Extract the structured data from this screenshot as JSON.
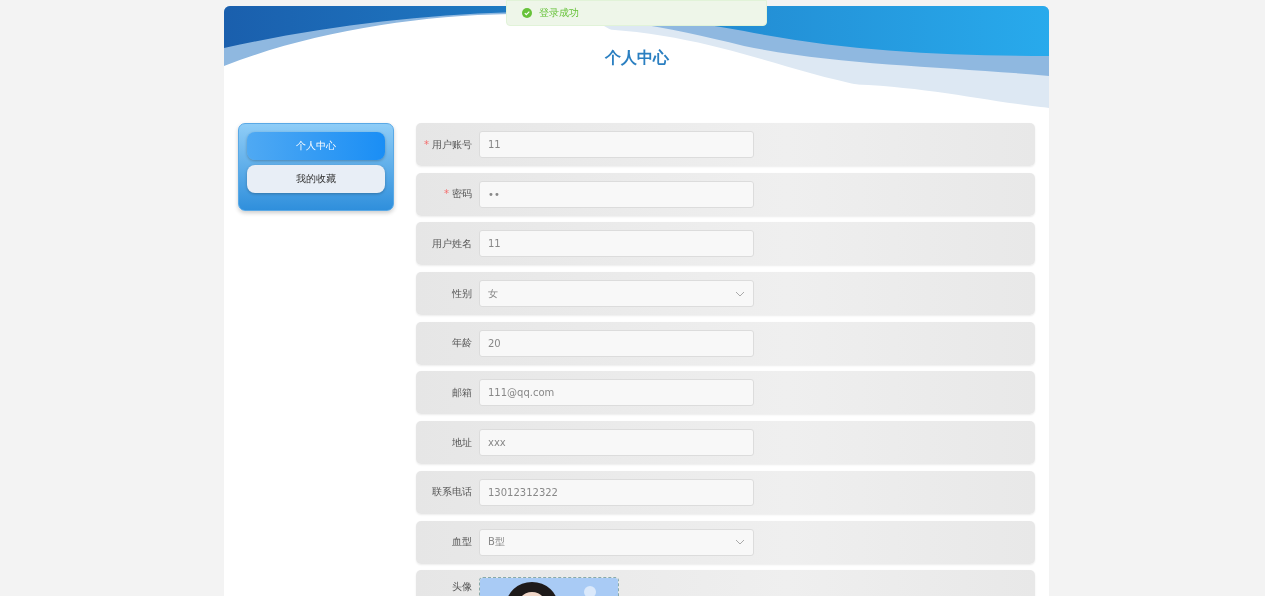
{
  "toast": {
    "kind": "success",
    "message": "登录成功"
  },
  "title": "个人中心",
  "sidebar": {
    "items": [
      {
        "label": "个人中心",
        "selected": true
      },
      {
        "label": "我的收藏",
        "selected": false
      }
    ]
  },
  "form": {
    "fields": [
      {
        "label": "用户账号",
        "required_mark": "*",
        "kind": "input",
        "value": "11"
      },
      {
        "label": "密码",
        "required_mark": "*",
        "kind": "input",
        "value": "••"
      },
      {
        "label": "用户姓名",
        "kind": "input",
        "value": "11"
      },
      {
        "label": "性别",
        "kind": "select",
        "value": "女"
      },
      {
        "label": "年龄",
        "kind": "input",
        "value": "20"
      },
      {
        "label": "邮箱",
        "kind": "input",
        "value": "111@qq.com"
      },
      {
        "label": "地址",
        "kind": "input",
        "value": "xxx"
      },
      {
        "label": "联系电话",
        "kind": "input",
        "value": "13012312322"
      },
      {
        "label": "血型",
        "kind": "select",
        "value": "B型"
      },
      {
        "label": "头像"
      }
    ]
  }
}
